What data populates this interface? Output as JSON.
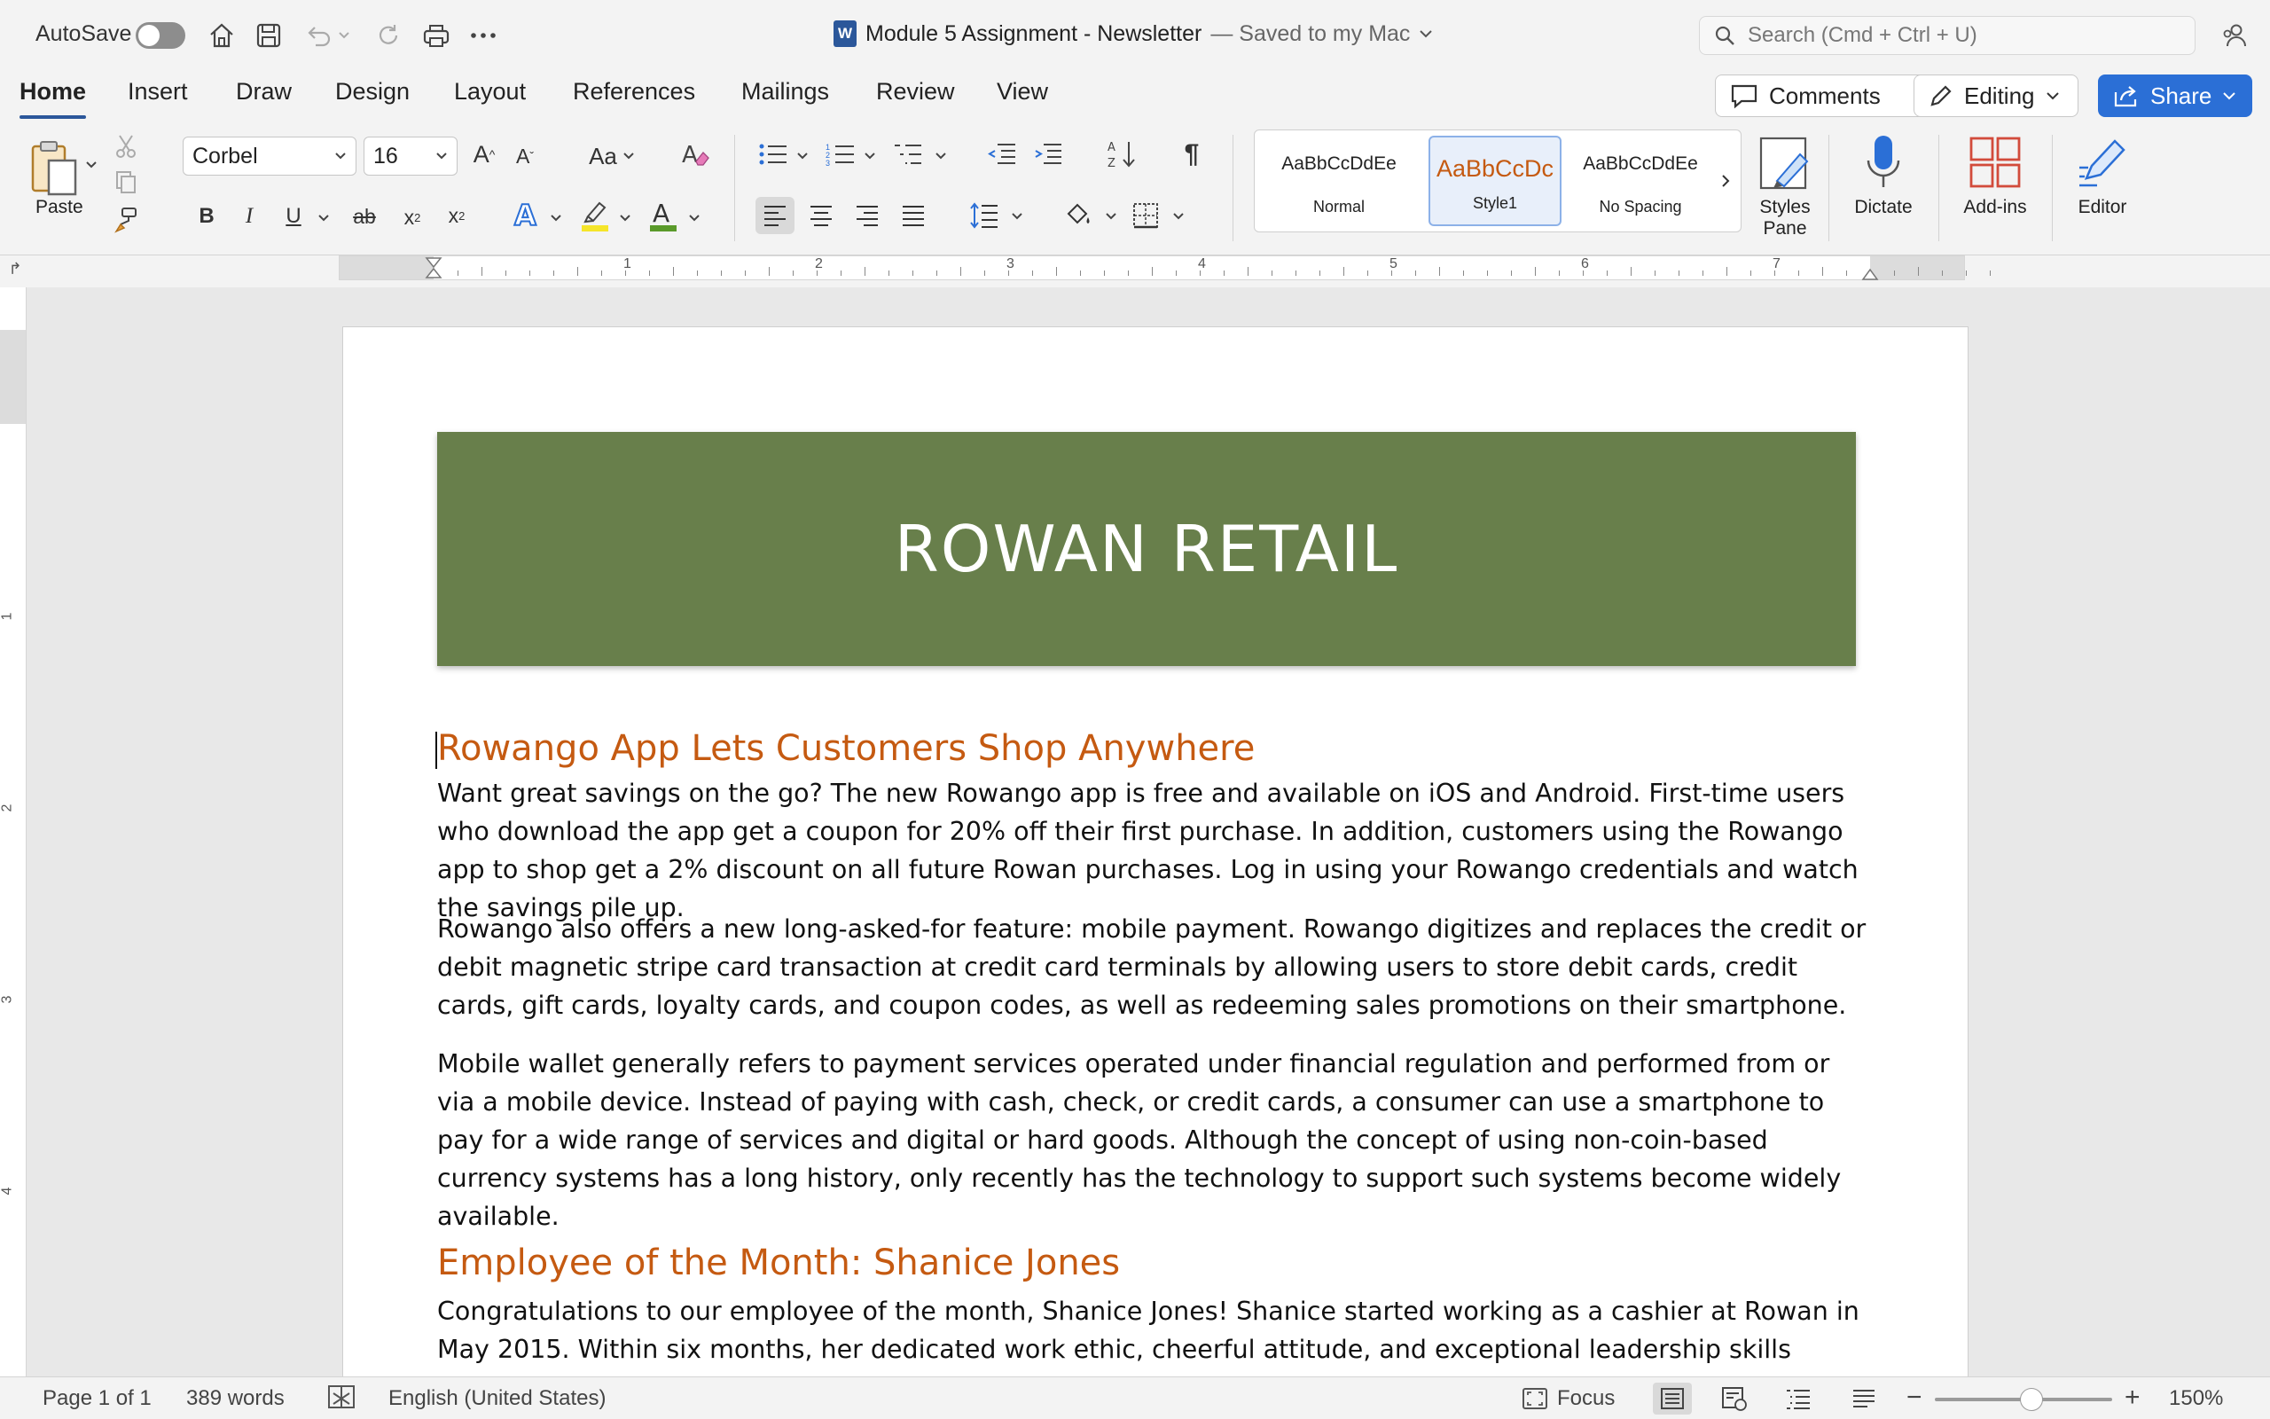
{
  "titlebar": {
    "autosave_label": "AutoSave",
    "doc_name": "Module 5 Assignment - Newsletter",
    "saved_status": "— Saved to my Mac",
    "search_placeholder": "Search (Cmd + Ctrl + U)"
  },
  "tabs": [
    "Home",
    "Insert",
    "Draw",
    "Design",
    "Layout",
    "References",
    "Mailings",
    "Review",
    "View"
  ],
  "active_tab": "Home",
  "actions": {
    "comments": "Comments",
    "editing": "Editing",
    "share": "Share"
  },
  "ribbon": {
    "paste_label": "Paste",
    "font_name": "Corbel",
    "font_size": "16",
    "styles": [
      {
        "sample": "AaBbCcDdEe",
        "name": "Normal"
      },
      {
        "sample": "AaBbCcDc",
        "name": "Style1"
      },
      {
        "sample": "AaBbCcDdEe",
        "name": "No Spacing"
      }
    ],
    "styles_pane": "Styles Pane",
    "dictate": "Dictate",
    "addins": "Add-ins",
    "editor": "Editor"
  },
  "ruler": {
    "h_numbers": [
      "1",
      "2",
      "3",
      "4",
      "5",
      "6",
      "7"
    ],
    "v_numbers": [
      "1",
      "2",
      "3",
      "4"
    ]
  },
  "document": {
    "banner": "ROWAN RETAIL",
    "heading1": "Rowango App Lets Customers Shop Anywhere",
    "para1": "Want great savings on the go? The new Rowango app is free and available on iOS and Android. First-time users who download the app get a coupon for 20% off their first purchase. In addition, customers using the Rowango app to shop get a 2% discount on all future Rowan purchases. Log in using your Rowango credentials and watch the savings pile up.",
    "para2": "Rowango also offers a new long-asked-for feature: mobile payment. Rowango digitizes and replaces the credit or debit magnetic stripe card transaction at credit card terminals by allowing users to store debit cards, credit cards, gift cards, loyalty cards, and coupon codes, as well as redeeming sales promotions on their smartphone.",
    "para3": "Mobile wallet generally refers to payment services operated under financial regulation and performed from or via a mobile device. Instead of paying with cash, check, or credit cards, a consumer can use a smartphone to pay for a wide range of services and digital or hard goods. Although the concept of using non-coin-based currency systems has a long history, only recently has the technology to support such systems become widely available.",
    "heading2": "Employee of the Month: Shanice Jones",
    "para4": "Congratulations to our employee of the month, Shanice Jones! Shanice started working as a cashier at Rowan in May 2015. Within six months, her dedicated work ethic, cheerful attitude, and exceptional leadership skills propelled her to being floor manager. When asked what she likes about working for Rowan, Shanice said, “I love all the great people I work with in our customer-focused environment."
  },
  "statusbar": {
    "page": "Page 1 of 1",
    "words": "389 words",
    "language": "English (United States)",
    "focus": "Focus",
    "zoom": "150%"
  },
  "colors": {
    "heading": "#c55a11",
    "banner": "#687f4b",
    "accent": "#2b579a",
    "share": "#2b6fd6"
  }
}
